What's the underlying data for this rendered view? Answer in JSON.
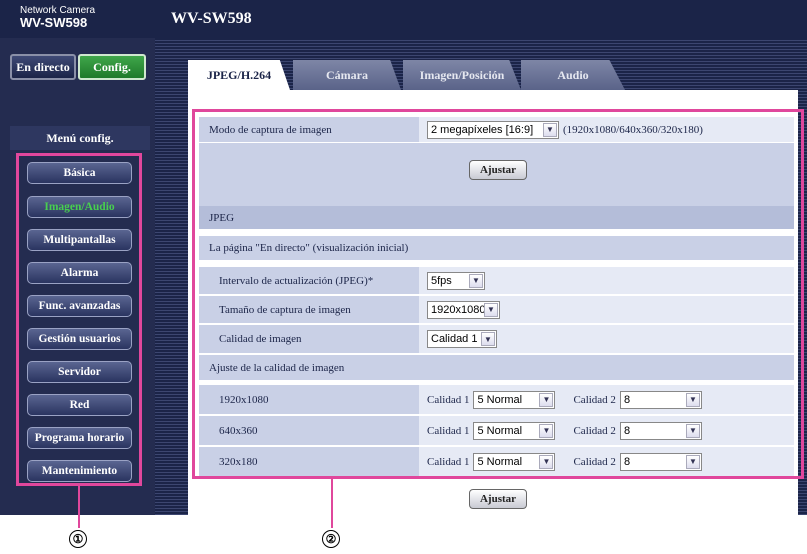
{
  "header": {
    "brand_small": "Network Camera",
    "brand_model": "WV-SW598",
    "title": "WV-SW598"
  },
  "mode_buttons": {
    "live": "En directo",
    "config": "Config."
  },
  "menu": {
    "title": "Menú config.",
    "items": [
      "Básica",
      "Imagen/Audio",
      "Multipantallas",
      "Alarma",
      "Func. avanzadas",
      "Gestión usuarios",
      "Servidor",
      "Red",
      "Programa horario",
      "Mantenimiento"
    ],
    "active_index": 1
  },
  "tabs": [
    "JPEG/H.264",
    "Cámara",
    "Imagen/Posición",
    "Audio"
  ],
  "capture": {
    "label": "Modo de captura de imagen",
    "value": "2 megapíxeles [16:9]",
    "note": "(1920x1080/640x360/320x180)",
    "set_button": "Ajustar"
  },
  "jpeg": {
    "section": "JPEG",
    "subsection": "La página \"En directo\" (visualización inicial)",
    "refresh_label": "Intervalo de actualización (JPEG)*",
    "refresh_value": "5fps",
    "size_label": "Tamaño de captura de imagen",
    "size_value": "1920x1080",
    "quality_label": "Calidad de imagen",
    "quality_value": "Calidad 1",
    "adjust_section": "Ajuste de la calidad de imagen",
    "quality_rows": [
      {
        "res": "1920x1080",
        "q1_label": "Calidad 1",
        "q1": "5 Normal",
        "q2_label": "Calidad 2",
        "q2": "8"
      },
      {
        "res": "640x360",
        "q1_label": "Calidad 1",
        "q1": "5 Normal",
        "q2_label": "Calidad 2",
        "q2": "8"
      },
      {
        "res": "320x180",
        "q1_label": "Calidad 1",
        "q1": "5 Normal",
        "q2_label": "Calidad 2",
        "q2": "8"
      }
    ],
    "set_button": "Ajustar"
  },
  "callouts": [
    "①",
    "②"
  ],
  "colors": {
    "navy": "#1b2448",
    "highlight": "#e0479c",
    "active_green": "#48d04f",
    "row": "#c9d0e6"
  }
}
